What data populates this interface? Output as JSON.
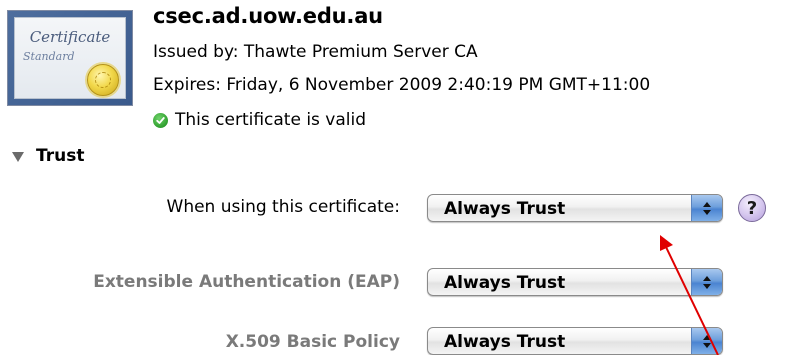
{
  "certificate": {
    "icon_text_line1": "Certificate",
    "icon_text_line2": "Standard",
    "name": "csec.ad.uow.edu.au",
    "issued_by": "Issued by: Thawte Premium Server CA",
    "expires": "Expires: Friday, 6 November 2009 2:40:19 PM GMT+11:00",
    "status": "This certificate is valid",
    "status_icon": "check-circle-icon"
  },
  "trust": {
    "header": "Trust",
    "disclosure_icon": "disclosure-triangle-down-icon",
    "rows": [
      {
        "label": "When using this certificate:",
        "value": "Always Trust"
      },
      {
        "label": "Extensible Authentication (EAP)",
        "value": "Always Trust"
      },
      {
        "label": "X.509 Basic Policy",
        "value": "Always Trust"
      }
    ],
    "help_label": "?"
  },
  "colors": {
    "valid_green": "#2f9e2e",
    "popup_arrow_blue": "#4b84d1",
    "annotation_arrow": "#e00000",
    "dim_label": "#7a7a7a"
  }
}
